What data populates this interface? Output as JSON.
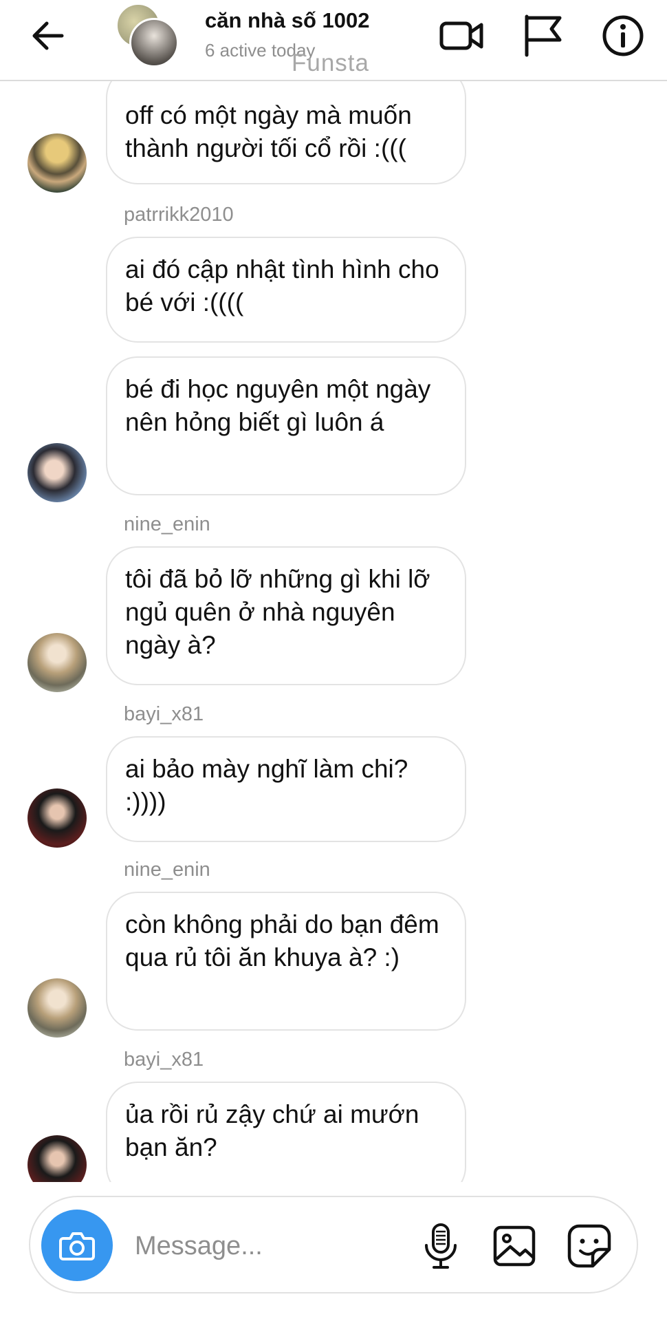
{
  "header": {
    "title": "căn nhà số 1002",
    "subtitle": "6 active today",
    "watermark": "Funsta",
    "icons": [
      "back-arrow-icon",
      "video-camera-icon",
      "flag-icon",
      "info-icon"
    ]
  },
  "messages": [
    {
      "text": "off có một ngày mà muốn thành người tối cổ rồi :((("
    },
    {
      "username": "patrrikk2010"
    },
    {
      "text": "ai đó cập nhật tình hình cho bé với :(((("
    },
    {
      "text": "bé đi học nguyên một ngày nên hỏng biết gì luôn á"
    },
    {
      "username": "nine_enin"
    },
    {
      "text": "tôi đã bỏ lỡ những gì khi lỡ ngủ quên ở nhà nguyên ngày à?"
    },
    {
      "username": "bayi_x81"
    },
    {
      "text": "ai bảo mày nghĩ làm chi? :))))"
    },
    {
      "username": "nine_enin"
    },
    {
      "text": "còn không phải do bạn đêm qua rủ tôi ăn khuya à? :)"
    },
    {
      "username": "bayi_x81"
    },
    {
      "text": "ủa rồi rủ zậy chứ ai mướn bạn ăn?"
    }
  ],
  "composer": {
    "placeholder": "Message...",
    "icons": [
      "camera-icon",
      "microphone-icon",
      "gallery-icon",
      "sticker-icon"
    ],
    "accent": "#3797f0"
  }
}
